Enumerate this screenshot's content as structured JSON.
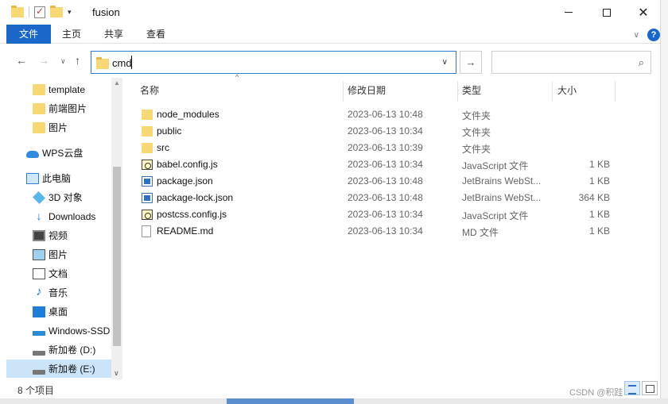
{
  "window": {
    "title": "fusion",
    "minimize": "—",
    "maximize": "□",
    "close": "✕"
  },
  "ribbon": {
    "tabs": [
      {
        "label": "文件"
      },
      {
        "label": "主页"
      },
      {
        "label": "共享"
      },
      {
        "label": "查看"
      }
    ],
    "help": "?"
  },
  "address": {
    "path": "cmd",
    "search_placeholder": ""
  },
  "sidebar": {
    "items": [
      {
        "label": "template",
        "icon": "folder-icon"
      },
      {
        "label": "前端图片",
        "icon": "folder-icon"
      },
      {
        "label": "图片",
        "icon": "folder-icon"
      },
      {
        "label": "WPS云盘",
        "icon": "cloud-icon"
      },
      {
        "label": "此电脑",
        "icon": "computer-icon"
      },
      {
        "label": "3D 对象",
        "icon": "3d-objects-icon"
      },
      {
        "label": "Downloads",
        "icon": "download-icon"
      },
      {
        "label": "视频",
        "icon": "video-icon"
      },
      {
        "label": "图片",
        "icon": "pictures-icon"
      },
      {
        "label": "文档",
        "icon": "documents-icon"
      },
      {
        "label": "音乐",
        "icon": "music-icon"
      },
      {
        "label": "桌面",
        "icon": "desktop-icon"
      },
      {
        "label": "Windows-SSD",
        "icon": "ssd-drive-icon"
      },
      {
        "label": "新加卷 (D:)",
        "icon": "drive-icon"
      },
      {
        "label": "新加卷 (E:)",
        "icon": "drive-icon"
      }
    ]
  },
  "columns": {
    "name": "名称",
    "date": "修改日期",
    "type": "类型",
    "size": "大小"
  },
  "files": [
    {
      "name": "node_modules",
      "date": "2023-06-13 10:48",
      "type": "文件夹",
      "size": "",
      "icon": "folder-icon"
    },
    {
      "name": "public",
      "date": "2023-06-13 10:34",
      "type": "文件夹",
      "size": "",
      "icon": "folder-icon"
    },
    {
      "name": "src",
      "date": "2023-06-13 10:39",
      "type": "文件夹",
      "size": "",
      "icon": "folder-icon"
    },
    {
      "name": "babel.config.js",
      "date": "2023-06-13 10:34",
      "type": "JavaScript 文件",
      "size": "1 KB",
      "icon": "js-file-icon"
    },
    {
      "name": "package.json",
      "date": "2023-06-13 10:48",
      "type": "JetBrains WebSt...",
      "size": "1 KB",
      "icon": "json-file-icon"
    },
    {
      "name": "package-lock.json",
      "date": "2023-06-13 10:48",
      "type": "JetBrains WebSt...",
      "size": "364 KB",
      "icon": "json-file-icon"
    },
    {
      "name": "postcss.config.js",
      "date": "2023-06-13 10:34",
      "type": "JavaScript 文件",
      "size": "1 KB",
      "icon": "js-file-icon"
    },
    {
      "name": "README.md",
      "date": "2023-06-13 10:34",
      "type": "MD 文件",
      "size": "1 KB",
      "icon": "md-file-icon"
    }
  ],
  "status": {
    "item_count": "8 个项目"
  },
  "watermark": "CSDN @积跬",
  "colors": {
    "accent": "#1a66c9",
    "folder": "#f8d775",
    "selection": "#cce4f7"
  }
}
